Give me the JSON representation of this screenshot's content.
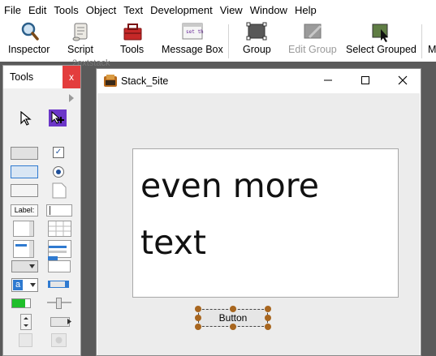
{
  "menu": [
    "File",
    "Edit",
    "Tools",
    "Object",
    "Text",
    "Development",
    "View",
    "Window",
    "Help"
  ],
  "toolbar": {
    "inspector": "Inspector",
    "script": "Script",
    "tools": "Tools",
    "message_box": "Message Box",
    "group": "Group",
    "edit_group": "Edit Group",
    "select_grouped": "Select Grouped",
    "more": "M"
  },
  "ghost_label": "2extstack",
  "tools_palette": {
    "title": "Tools",
    "close": "x",
    "label_tool": "Label:"
  },
  "stack_window": {
    "title": "Stack_5ite",
    "field_text_line1": "even more",
    "field_text_line2": "text",
    "button_label": "Button"
  },
  "colors": {
    "close_red": "#e33d3d",
    "handle_brown": "#a8661f"
  }
}
